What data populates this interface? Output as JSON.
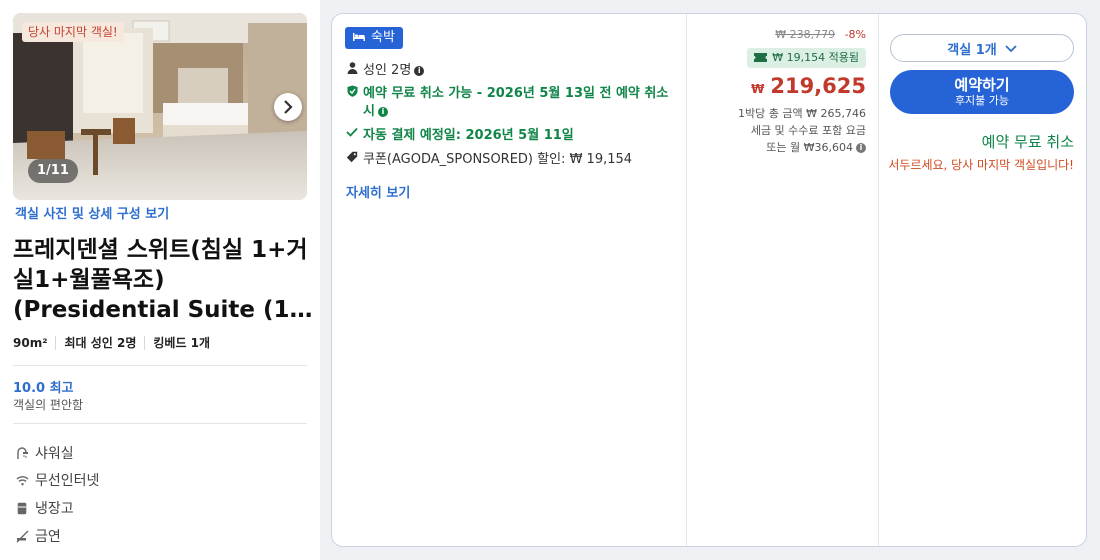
{
  "room": {
    "badge_last_room": "당사 마지막 객실!",
    "photo_counter": "1/11",
    "photo_link": "객실 사진 및 상세 구성 보기",
    "title": "프레지덴셜 스위트(침실 1+거실1+월풀욕조) (Presidential Suite (1…",
    "specs": {
      "size": "90m²",
      "max_guests": "최대 성인 2명",
      "bed": "킹베드 1개"
    },
    "rating": {
      "score": "10.0 최고",
      "label": "객실의 편안함"
    },
    "amenities": [
      {
        "icon": "shower-icon",
        "label": "샤워실"
      },
      {
        "icon": "wifi-icon",
        "label": "무선인터넷"
      },
      {
        "icon": "fridge-icon",
        "label": "냉장고"
      },
      {
        "icon": "no-smoking-icon",
        "label": "금연"
      }
    ]
  },
  "offer": {
    "type_badge": "숙박",
    "guests": "성인 2명",
    "free_cancel": "예약 무료 취소 가능 - 2026년 5월 13일 전 예약 취소 시",
    "auto_payment": "자동 결제 예정일: 2026년 5월 11일",
    "coupon": "쿠폰(AGODA_SPONSORED) 할인: ₩ 19,154",
    "details_link": "자세히 보기"
  },
  "price": {
    "original": "₩ 238,779",
    "discount": "-8%",
    "coupon_applied": "₩ 19,154 적용됨",
    "currency_symbol": "₩",
    "final": "219,625",
    "per_night_total": "1박당 총 금액 ₩ 265,746",
    "tax_note": "세금 및 수수료 포함 요금",
    "monthly": "또는 월 ₩36,604"
  },
  "booking": {
    "room_select": "객실 1개",
    "book_button": "예약하기",
    "pay_later": "후지불 가능",
    "free_cancel": "예약 무료 취소",
    "hurry": "서두르세요, 당사 마지막 객실입니다!"
  },
  "colors": {
    "accent_blue": "#2563d6",
    "link_blue": "#2d6ecf",
    "price_red": "#c0392b",
    "success_green": "#108548",
    "urgency_orange": "#d24b1f"
  }
}
